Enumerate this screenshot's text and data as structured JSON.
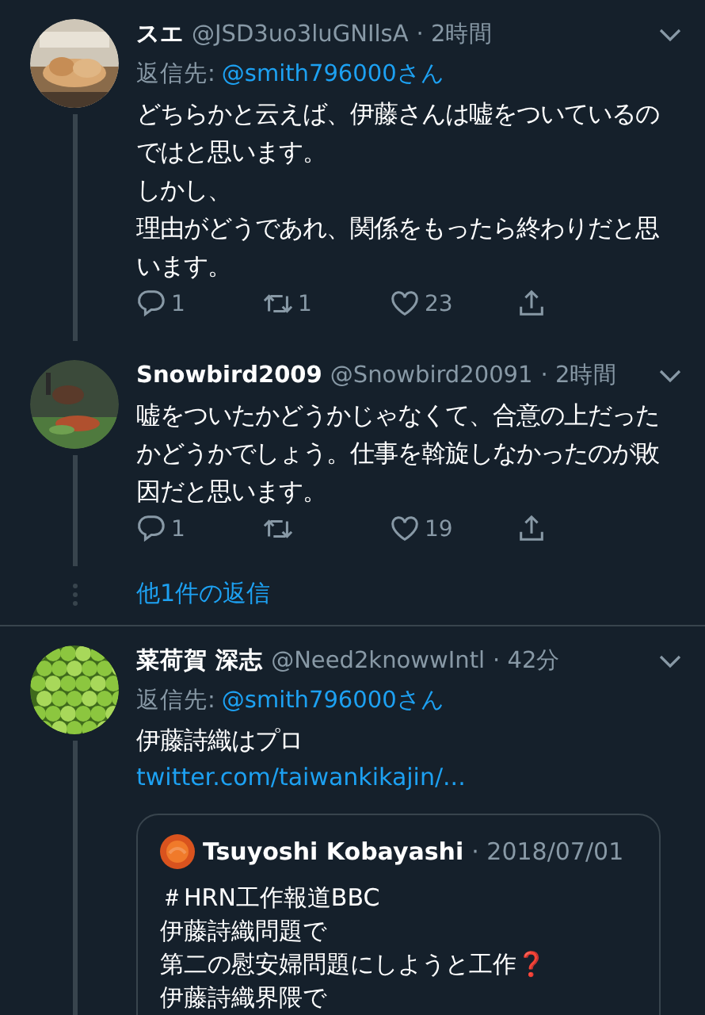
{
  "tweets": [
    {
      "kind": "reply",
      "name": "スエ",
      "handle": "@JSD3uo3luGNIlsA",
      "time": "· 2時間",
      "reply_label": "返信先:",
      "reply_handle": "@smith796000さん",
      "thread_below": true,
      "body": [
        "どちらかと云えば、伊藤さんは嘘をついているのではと思います。",
        "しかし、",
        "理由がどうであれ、関係をもったら終わりだと思います。"
      ],
      "actions": [
        {
          "kind": "reply",
          "count": "1"
        },
        {
          "kind": "retweet",
          "count": "1"
        },
        {
          "kind": "like",
          "count": "23"
        },
        {
          "kind": "share"
        }
      ]
    },
    {
      "kind": "reply",
      "name": "Snowbird2009",
      "handle": "@Snowbird20091",
      "time": "· 2時間",
      "thread_below": true,
      "body": [
        "嘘をついたかどうかじゃなくて、合意の上だったかどうかでしょう。仕事を斡旋しなかったのが敗因だと思います。"
      ],
      "actions": [
        {
          "kind": "reply",
          "count": "1"
        },
        {
          "kind": "retweet"
        },
        {
          "kind": "like",
          "count": "19"
        },
        {
          "kind": "share"
        }
      ]
    },
    {
      "kind": "more",
      "text": "他1件の返信"
    },
    {
      "kind": "reply",
      "name": "菜荷賀 深志",
      "handle": "@Need2knowwIntl",
      "time": "· 42分",
      "reply_label": "返信先:",
      "reply_handle": "@smith796000さん",
      "thread_below": true,
      "body": [
        "伊藤詩織はプロ"
      ],
      "link": "twitter.com/taiwankikajin/...",
      "quote": {
        "name": "Tsuyoshi Kobayashi",
        "time": "· 2018/07/01",
        "lines": [
          "＃HRN工作報道BBC",
          "伊藤詩織問題で",
          "第二の慰安婦問題にしようと工作❓",
          "伊藤詩織界隈で"
        ]
      }
    }
  ]
}
